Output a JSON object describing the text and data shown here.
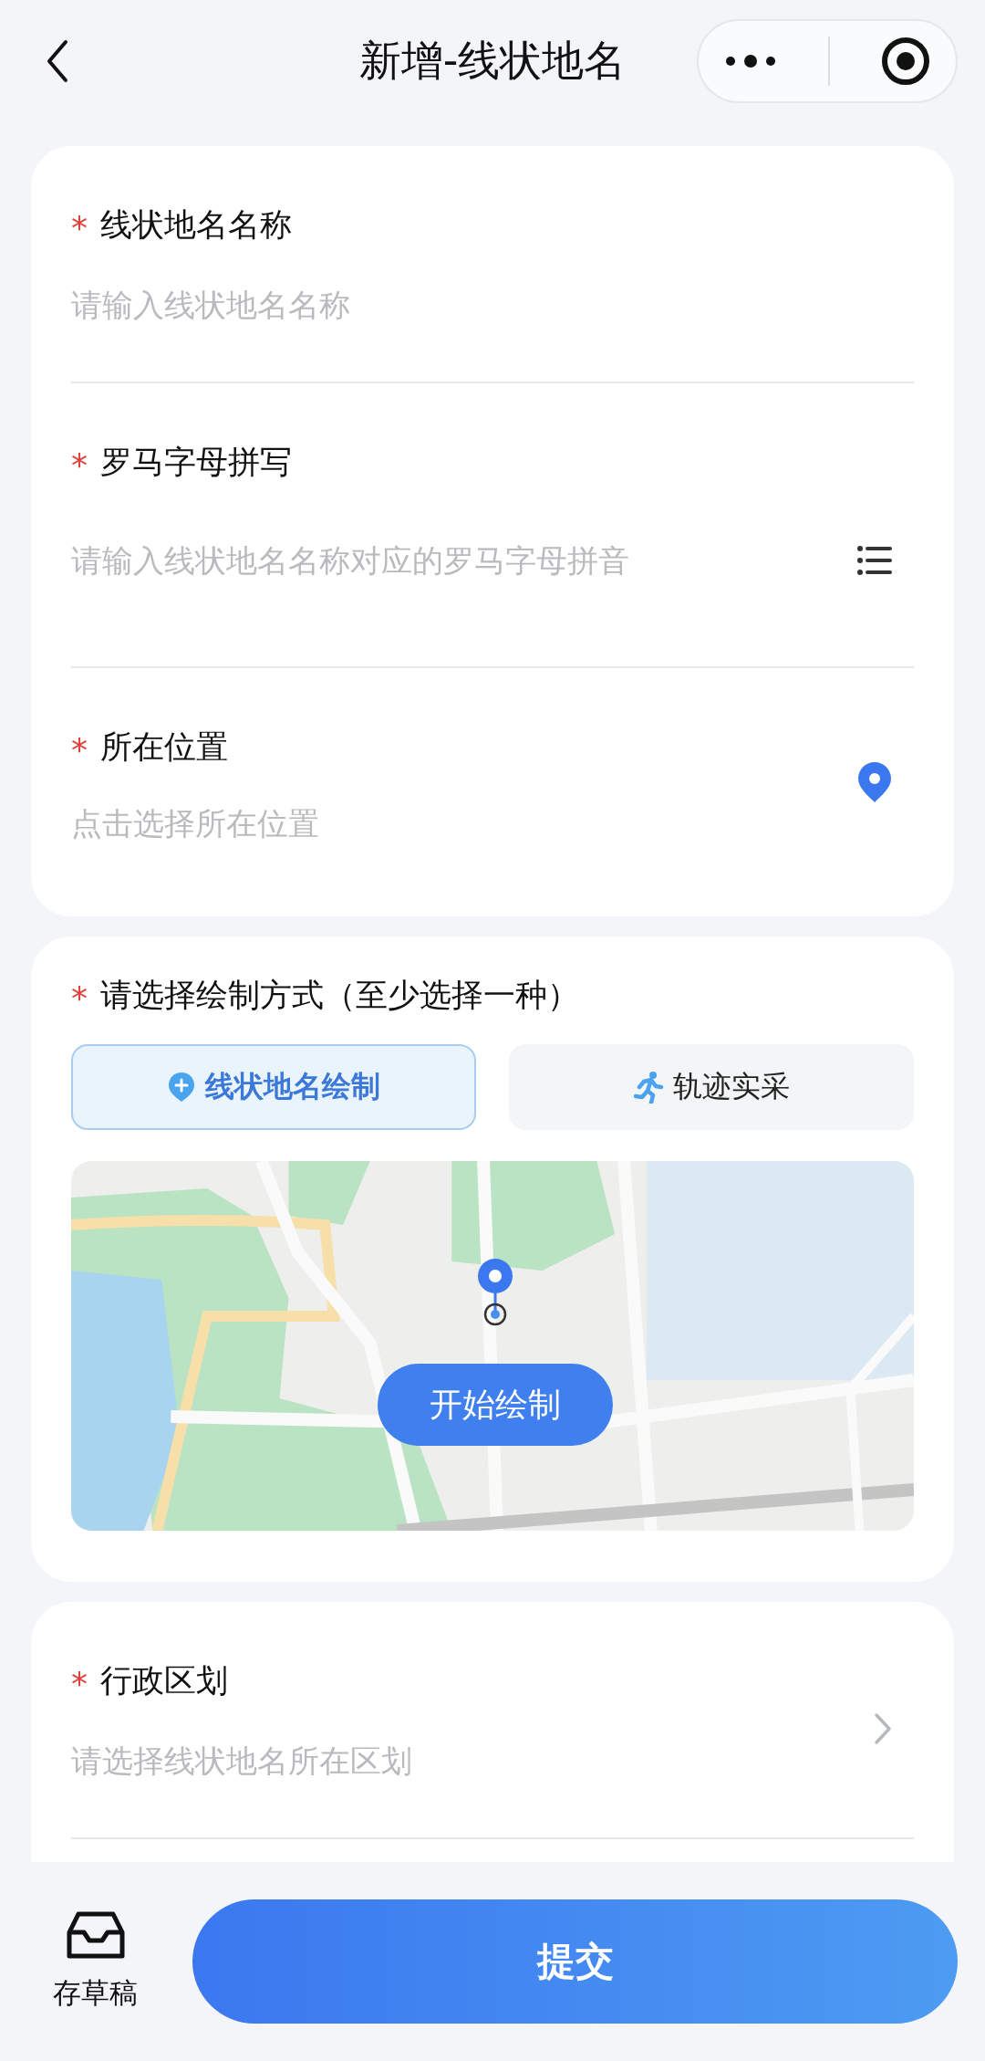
{
  "nav": {
    "title": "新增-线状地名"
  },
  "cards": [
    {
      "fields": [
        {
          "kind": "text",
          "label": "线状地名名称",
          "required_mark": "*",
          "placeholder": "请输入线状地名名称",
          "divider": true
        },
        {
          "kind": "list",
          "label": "罗马字母拼写",
          "required_mark": "*",
          "placeholder": "请输入线状地名名称对应的罗马字母拼音",
          "divider": true
        },
        {
          "kind": "location",
          "label": "所在位置",
          "required_mark": "*",
          "placeholder": "点击选择所在位置",
          "divider": false
        }
      ]
    },
    {
      "draw": {
        "label": "请选择绘制方式（至少选择一种）",
        "required_mark": "*",
        "tabs": [
          {
            "kind": "draw",
            "label": "线状地名绘制",
            "selected": true
          },
          {
            "kind": "track",
            "label": "轨迹实采",
            "selected": false
          }
        ],
        "map": {
          "kind": "picture",
          "button": "开始绘制"
        }
      }
    },
    {
      "fields": [
        {
          "kind": "select",
          "label": "行政区划",
          "required_mark": "*",
          "placeholder": "请选择线状地名所在区划",
          "divider": true
        }
      ]
    }
  ],
  "footer": {
    "draft": "存草稿",
    "submit": "提交"
  }
}
